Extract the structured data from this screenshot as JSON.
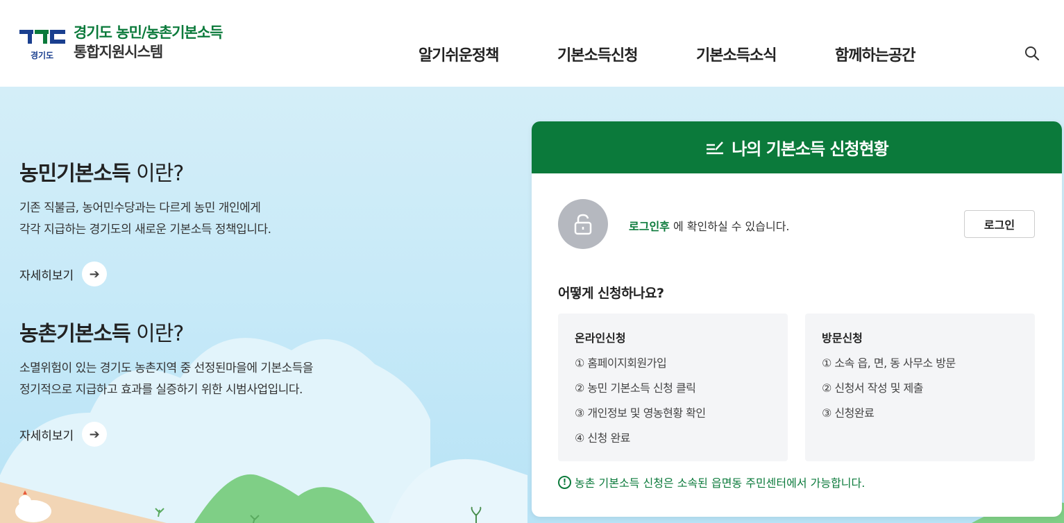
{
  "header": {
    "logo_line1": "경기도 농민/농촌기본소득",
    "logo_line2": "통합지원시스템",
    "logo_sub": "경기도",
    "nav": [
      "알기쉬운정책",
      "기본소득신청",
      "기본소득소식",
      "함께하는공간"
    ]
  },
  "sections": [
    {
      "title_bold": "농민기본소득",
      "title_light": " 이란?",
      "desc1": "기존 직불금, 농어민수당과는 다르게 농민 개인에게",
      "desc2": "각각 지급하는 경기도의 새로운 기본소득 정책입니다.",
      "more": "자세히보기"
    },
    {
      "title_bold": "농촌기본소득",
      "title_light": " 이란?",
      "desc1": "소멸위험이 있는 경기도 농촌지역 중 선정된마을에 기본소득을",
      "desc2": "정기적으로 지급하고 효과를 실증하기 위한 시범사업입니다.",
      "more": "자세히보기"
    }
  ],
  "card": {
    "title": "나의 기본소득 신청현황",
    "login_green": "로그인후",
    "login_rest": " 에 확인하실 수 있습니다.",
    "login_button": "로그인",
    "how_title": "어떻게 신청하나요?",
    "online": {
      "title": "온라인신청",
      "steps": [
        "① 홈페이지회원가입",
        "② 농민 기본소득 신청 클릭",
        "③ 개인정보 및 영농현황 확인",
        "④ 신청 완료"
      ]
    },
    "visit": {
      "title": "방문신청",
      "steps": [
        "① 소속 읍, 면, 동 사무소 방문",
        "② 신청서 작성 및 제출",
        "③ 신청완료"
      ]
    },
    "notice": "농촌 기본소득 신청은 소속된 읍면동 주민센터에서 가능합니다."
  },
  "colors": {
    "brand_green": "#0b7a3b",
    "brand_blue": "#1a3f8f",
    "sky": "#c8eaf8"
  }
}
